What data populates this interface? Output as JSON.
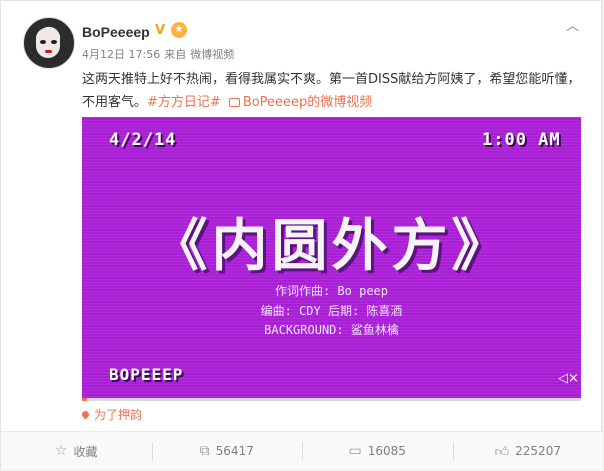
{
  "post": {
    "username": "BoPeeeep",
    "verified_badge": "V",
    "medal_icon": "medal-icon",
    "timestamp": "4月12日 17:56",
    "source_prefix": "来自",
    "source": "微博视频",
    "text_main": "这两天推特上好不热闹，看得我属实不爽。第一首DISS献给方阿姨了，希望您能听懂，不用客气。",
    "hashtag": "#方方日记#",
    "video_link": "BoPeeeep的微博视频",
    "location": "为了押韵"
  },
  "video": {
    "date": "4/2/14",
    "time": "1:00 AM",
    "title": "《内圆外方》",
    "credit_line1": "作词作曲: Bo peep",
    "credit_line2": "编曲: CDY 后期: 陈喜酒",
    "credit_line3": "BACKGROUND: 鲨鱼林檎",
    "footer": "BOPEEEP",
    "background_color": "#a91fd6",
    "progress": 0.01
  },
  "actions": {
    "favorite_label": "收藏",
    "repost_count": "56417",
    "comment_count": "16085",
    "like_count": "225207"
  },
  "colors": {
    "accent": "#eb7350",
    "verified": "#f6a41a"
  }
}
